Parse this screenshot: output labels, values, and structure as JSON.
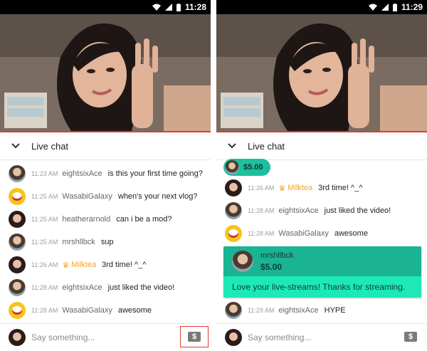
{
  "left": {
    "clock": "11:28",
    "chat_title": "Live chat",
    "messages": [
      {
        "time": "11:23 AM",
        "author": "eightsixAce",
        "text": "is this your first time going?"
      },
      {
        "time": "11:25 AM",
        "author": "WasabiGalaxy",
        "text": "when's your next vlog?"
      },
      {
        "time": "11:25 AM",
        "author": "heatherarnold",
        "text": "can i be a mod?"
      },
      {
        "time": "11:25 AM",
        "author": "mrshllbck",
        "text": "sup"
      },
      {
        "time": "11:26 AM",
        "author": "Milktea",
        "text": "3rd time! ^_^"
      },
      {
        "time": "11:28 AM",
        "author": "eightsixAce",
        "text": "just liked the video!"
      },
      {
        "time": "11:28 AM",
        "author": "WasabiGalaxy",
        "text": "awesome"
      }
    ],
    "input_placeholder": "Say something...",
    "dollar_symbol": "$"
  },
  "right": {
    "clock": "11:29",
    "chat_title": "Live chat",
    "ticker_amount": "$5.00",
    "messages": [
      {
        "time": "11:26 AM",
        "author": "Milktea",
        "text": "3rd time! ^_^"
      },
      {
        "time": "11:28 AM",
        "author": "eightsixAce",
        "text": "just liked the video!"
      },
      {
        "time": "11:28 AM",
        "author": "WasabiGalaxy",
        "text": "awesome"
      },
      {
        "time": "11:29 AM",
        "author": "eightsixAce",
        "text": "HYPE"
      }
    ],
    "superchat": {
      "name": "mrshllbck",
      "amount": "$5.00",
      "message": "Love your live-streams! Thanks for streaming."
    },
    "input_placeholder": "Say something...",
    "dollar_symbol": "$"
  },
  "icons": {
    "crown": "♛"
  },
  "colors": {
    "accent_red": "#e23b2f",
    "superchat_dark": "#1ab394",
    "superchat_light": "#1de9b6",
    "moderator_gold": "#f2a22c"
  }
}
